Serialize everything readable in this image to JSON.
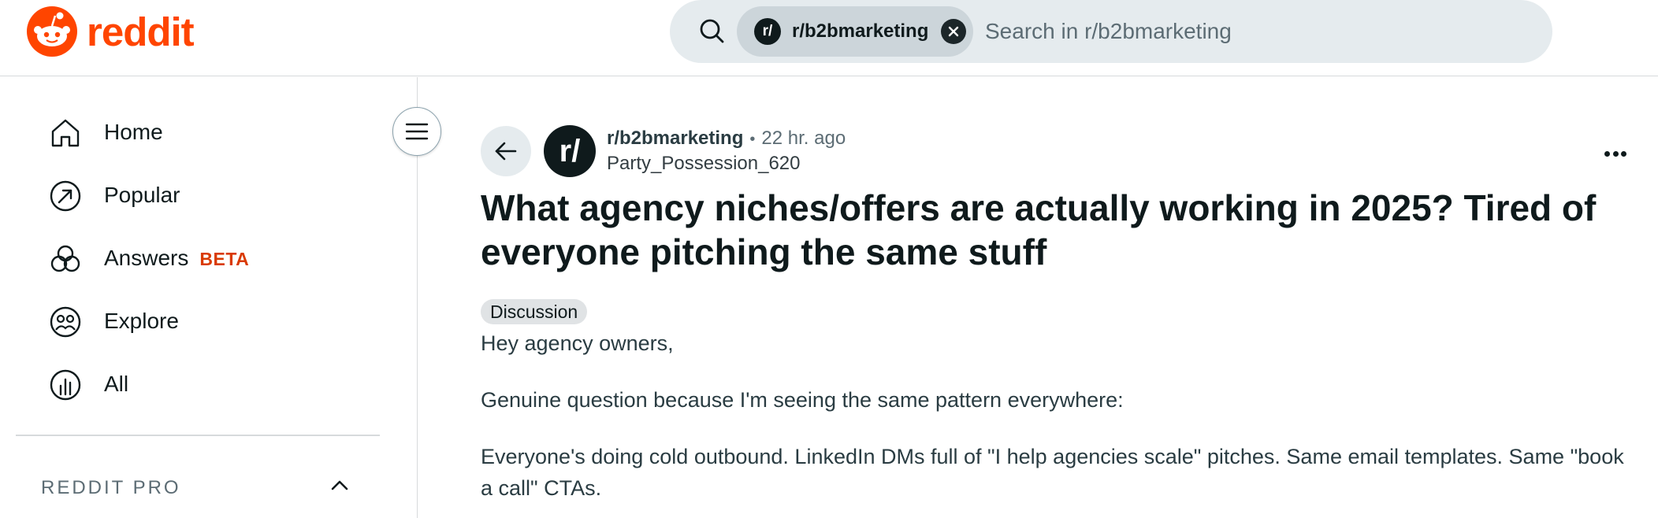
{
  "brand": {
    "name": "reddit",
    "color": "#ff4500"
  },
  "search": {
    "chip_avatar": "r/",
    "chip_label": "r/b2bmarketing",
    "placeholder": "Search in r/b2bmarketing"
  },
  "sidebar": {
    "items": [
      {
        "label": "Home",
        "icon": "home-icon"
      },
      {
        "label": "Popular",
        "icon": "popular-arrow-icon"
      },
      {
        "label": "Answers",
        "icon": "answers-icon",
        "badge": "BETA"
      },
      {
        "label": "Explore",
        "icon": "explore-icon"
      },
      {
        "label": "All",
        "icon": "all-chart-icon"
      }
    ],
    "section_title": "REDDIT PRO"
  },
  "post": {
    "subreddit_avatar": "r/",
    "subreddit": "r/b2bmarketing",
    "separator": "•",
    "time": "22 hr. ago",
    "author": "Party_Possession_620",
    "title": "What agency niches/offers are actually working in 2025? Tired of everyone pitching the same stuff",
    "flair": "Discussion",
    "body": [
      "Hey agency owners,",
      "Genuine question because I'm seeing the same pattern everywhere:",
      "Everyone's doing cold outbound. LinkedIn DMs full of \"I help agencies scale\" pitches. Same email templates. Same \"book a call\" CTAs."
    ]
  }
}
